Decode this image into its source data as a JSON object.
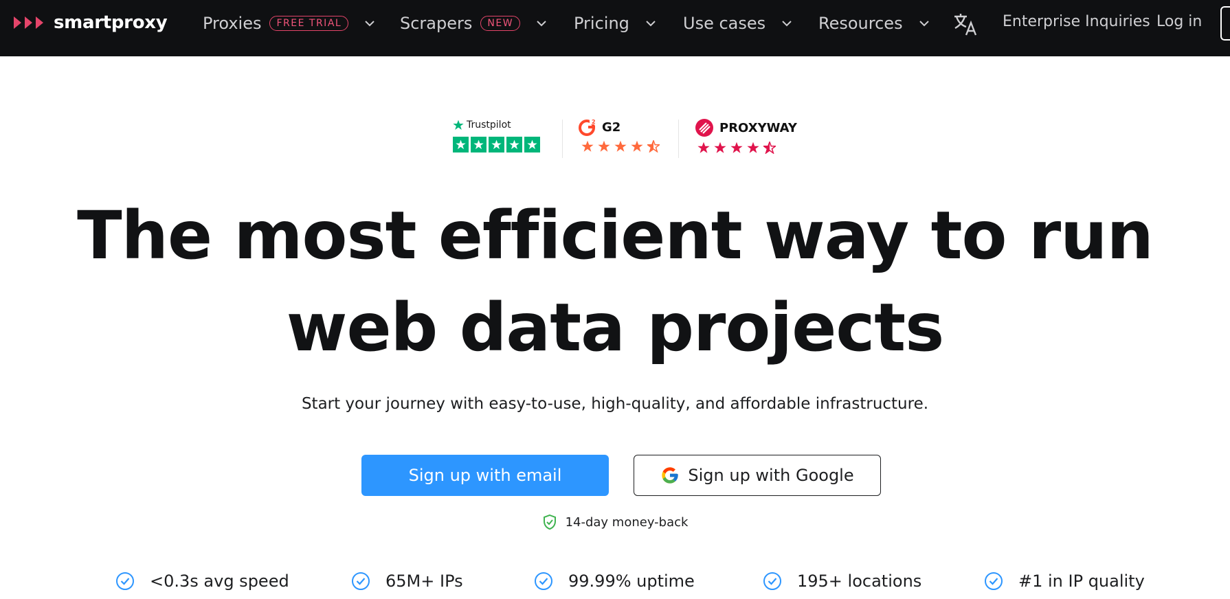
{
  "brand": {
    "name": "smartproxy"
  },
  "nav": {
    "items": [
      {
        "label": "Proxies",
        "badge": "FREE TRIAL",
        "icon": "chevron-down-icon"
      },
      {
        "label": "Scrapers",
        "badge": "NEW",
        "icon": "chevron-down-icon"
      },
      {
        "label": "Pricing",
        "icon": "chevron-down-icon"
      },
      {
        "label": "Use cases",
        "icon": "chevron-down-icon"
      },
      {
        "label": "Resources",
        "icon": "chevron-down-icon"
      }
    ],
    "language_icon": "translate-icon",
    "enterprise": "Enterprise Inquiries",
    "login": "Log in"
  },
  "ratings": {
    "trustpilot": {
      "label": "Trustpilot",
      "stars": 5
    },
    "g2": {
      "label": "G2",
      "stars": 4.5
    },
    "proxyway": {
      "label": "PROXYWAY",
      "stars": 4.5
    }
  },
  "hero": {
    "title_line1": "The most efficient way to run",
    "title_line2": "web data projects",
    "subtitle": "Start your journey with easy-to-use, high-quality, and affordable infrastructure."
  },
  "cta": {
    "email": "Sign up with email",
    "google": "Sign up with Google",
    "moneyback": "14-day money-back"
  },
  "features": [
    {
      "label": "<0.3s avg speed",
      "icon": "check-circle-icon"
    },
    {
      "label": "65M+ IPs",
      "icon": "check-circle-icon"
    },
    {
      "label": "99.99% uptime",
      "icon": "check-circle-icon"
    },
    {
      "label": "195+ locations",
      "icon": "check-circle-icon"
    },
    {
      "label": "#1 in IP quality",
      "icon": "check-circle-icon"
    }
  ],
  "colors": {
    "nav_bg": "#0f1012",
    "brand_red": "#e4456a",
    "primary_blue": "#2d96ff",
    "trustpilot_green": "#00b67a",
    "g2_star": "#ff6a3d",
    "proxyway_star": "#e0144c",
    "check_blue": "#2d96ff"
  }
}
